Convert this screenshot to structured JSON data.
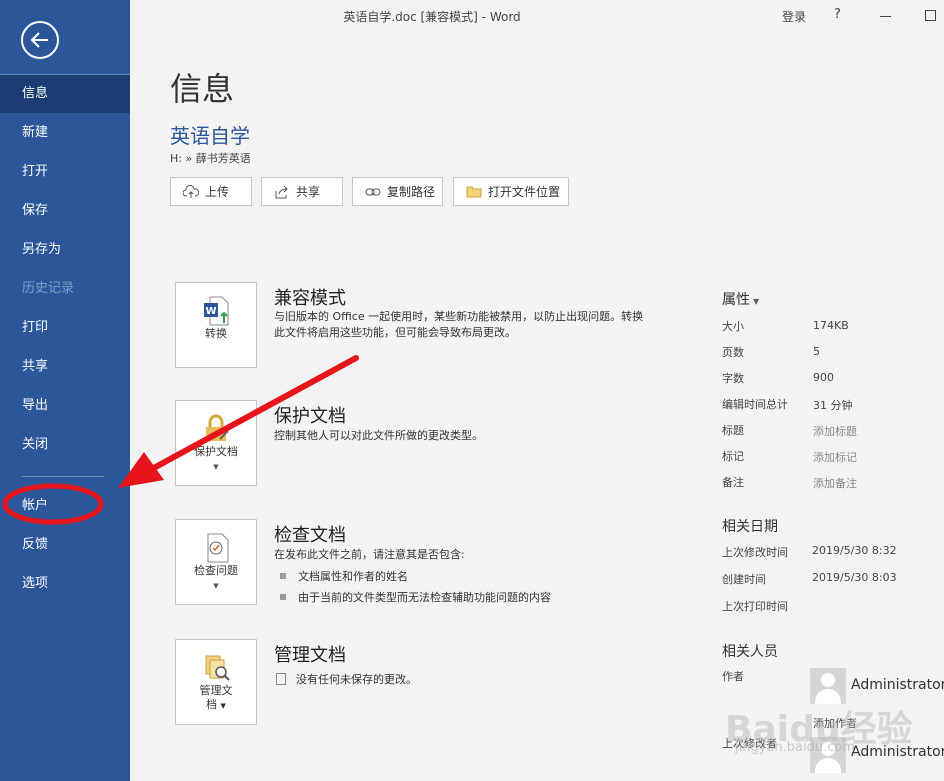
{
  "window": {
    "title": "英语自学.doc [兼容模式]  -  Word",
    "signin": "登录",
    "help": "?"
  },
  "sidebar": {
    "items": [
      {
        "label": "信息",
        "state": "active"
      },
      {
        "label": "新建",
        "state": "normal"
      },
      {
        "label": "打开",
        "state": "normal"
      },
      {
        "label": "保存",
        "state": "normal"
      },
      {
        "label": "另存为",
        "state": "normal"
      },
      {
        "label": "历史记录",
        "state": "disabled"
      },
      {
        "label": "打印",
        "state": "normal"
      },
      {
        "label": "共享",
        "state": "normal"
      },
      {
        "label": "导出",
        "state": "normal"
      },
      {
        "label": "关闭",
        "state": "normal"
      },
      {
        "label": "帐户",
        "state": "normal"
      },
      {
        "label": "反馈",
        "state": "normal"
      },
      {
        "label": "选项",
        "state": "normal"
      }
    ]
  },
  "header": {
    "heading": "信息",
    "doc_name": "英语自学",
    "path": "H: » 薛书芳英语"
  },
  "actions": {
    "upload": "上传",
    "share": "共享",
    "copy_path": "复制路径",
    "open_location": "打开文件位置"
  },
  "sections": {
    "compat": {
      "tile": "转换",
      "title": "兼容模式",
      "desc": "与旧版本的 Office 一起使用时，某些新功能被禁用，以防止出现问题。转换此文件将启用这些功能，但可能会导致布局更改。"
    },
    "protect": {
      "tile": "保护文档",
      "title": "保护文档",
      "desc": "控制其他人可以对此文件所做的更改类型。"
    },
    "inspect": {
      "tile": "检查问题",
      "title": "检查文档",
      "desc": "在发布此文件之前，请注意其是否包含:",
      "bullets": [
        "文档属性和作者的姓名",
        "由于当前的文件类型而无法检查辅助功能问题的内容"
      ]
    },
    "manage": {
      "tile_line1": "管理文",
      "tile_line2": "档",
      "title": "管理文档",
      "desc": "没有任何未保存的更改。"
    }
  },
  "properties": {
    "heading": "属性",
    "rows": [
      {
        "label": "大小",
        "value": "174KB"
      },
      {
        "label": "页数",
        "value": "5"
      },
      {
        "label": "字数",
        "value": "900"
      },
      {
        "label": "编辑时间总计",
        "value": "31 分钟"
      },
      {
        "label": "标题",
        "value": "添加标题"
      },
      {
        "label": "标记",
        "value": "添加标记"
      },
      {
        "label": "备注",
        "value": "添加备注"
      }
    ]
  },
  "dates": {
    "heading": "相关日期",
    "rows": [
      {
        "label": "上次修改时间",
        "value": "2019/5/30 8:32"
      },
      {
        "label": "创建时间",
        "value": "2019/5/30 8:03"
      },
      {
        "label": "上次打印时间",
        "value": ""
      }
    ]
  },
  "people": {
    "heading": "相关人员",
    "author_label": "作者",
    "author_name": "Administrator",
    "add_author": "添加作者",
    "modifier_label": "上次修改者",
    "modifier_name": "Administrator"
  },
  "watermark": {
    "text": "Baidu经验",
    "sub": "jingyan.baidu.com"
  },
  "colors": {
    "sidebar": "#2b579a",
    "sidebar_active": "#1b3d73",
    "annotation": "#e8141b",
    "link": "#2b579a"
  }
}
